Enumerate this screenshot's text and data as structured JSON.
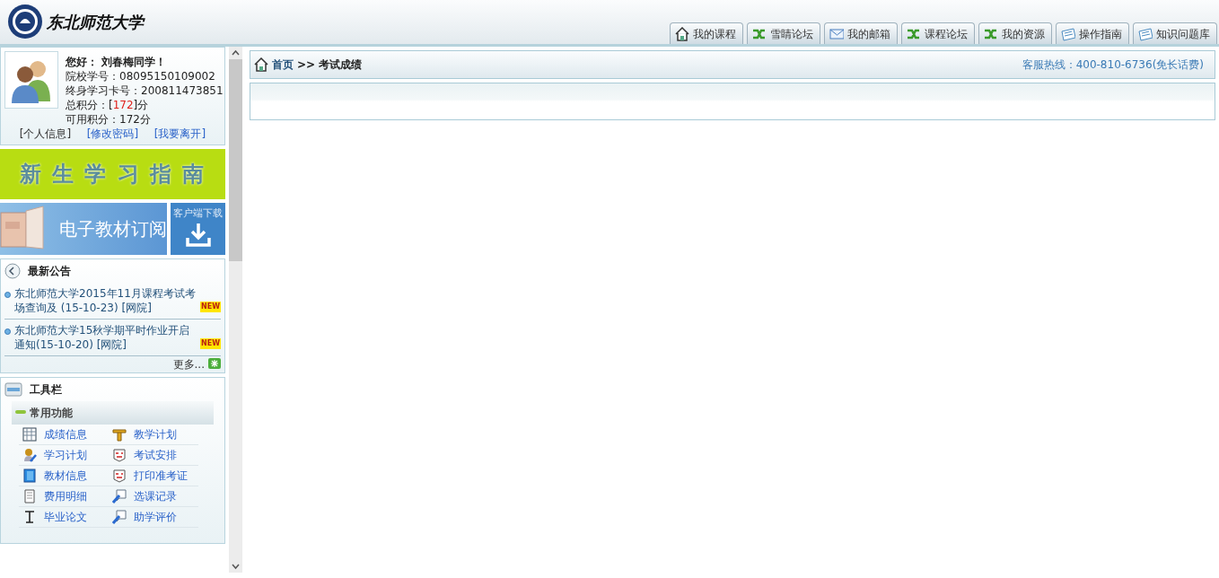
{
  "header": {
    "logo_text": "东北师范大学"
  },
  "nav_tabs": [
    {
      "label": "我的课程"
    },
    {
      "label": "雪睛论坛"
    },
    {
      "label": "我的邮箱"
    },
    {
      "label": "课程论坛"
    },
    {
      "label": "我的资源"
    },
    {
      "label": "操作指南"
    },
    {
      "label": "知识问题库"
    }
  ],
  "user": {
    "greeting": "您好：",
    "name": "刘春梅同学！",
    "school_id": "院校学号：08095150109002",
    "card_id": "终身学习卡号：200811473851",
    "total_points": {
      "before": "总积分：[",
      "value": "172",
      "after": "]分"
    },
    "usable_points": "可用积分：172分",
    "links": [
      {
        "label": "[个人信息]"
      },
      {
        "label": "[修改密码]"
      },
      {
        "label": "[我要离开]"
      }
    ]
  },
  "banners": {
    "guide": "新 生 学 习 指 南",
    "textbook": "电子教材订阅",
    "download": "客户端下载"
  },
  "notices": {
    "title": "最新公告",
    "items": [
      {
        "text": "东北师范大学2015年11月课程考试考场查询及 (15-10-23)",
        "source": "[网院]",
        "badge": "NEW"
      },
      {
        "text": "东北师范大学15秋学期平时作业开启通知(15-10-20)",
        "source": "[网院]",
        "badge": "NEW"
      }
    ],
    "more": "更多..."
  },
  "toolbar": {
    "title": "工具栏",
    "section": "常用功能",
    "items": [
      {
        "label": "成绩信息"
      },
      {
        "label": "教学计划"
      },
      {
        "label": "学习计划"
      },
      {
        "label": "考试安排"
      },
      {
        "label": "教材信息"
      },
      {
        "label": "打印准考证"
      },
      {
        "label": "费用明细"
      },
      {
        "label": "选课记录"
      },
      {
        "label": "毕业论文"
      },
      {
        "label": "助学评价"
      }
    ]
  },
  "breadcrumb": {
    "home": "首页",
    "separator": ">>",
    "current": "考试成绩"
  },
  "hotline": "客服热线：400-810-6736(免长话费)"
}
